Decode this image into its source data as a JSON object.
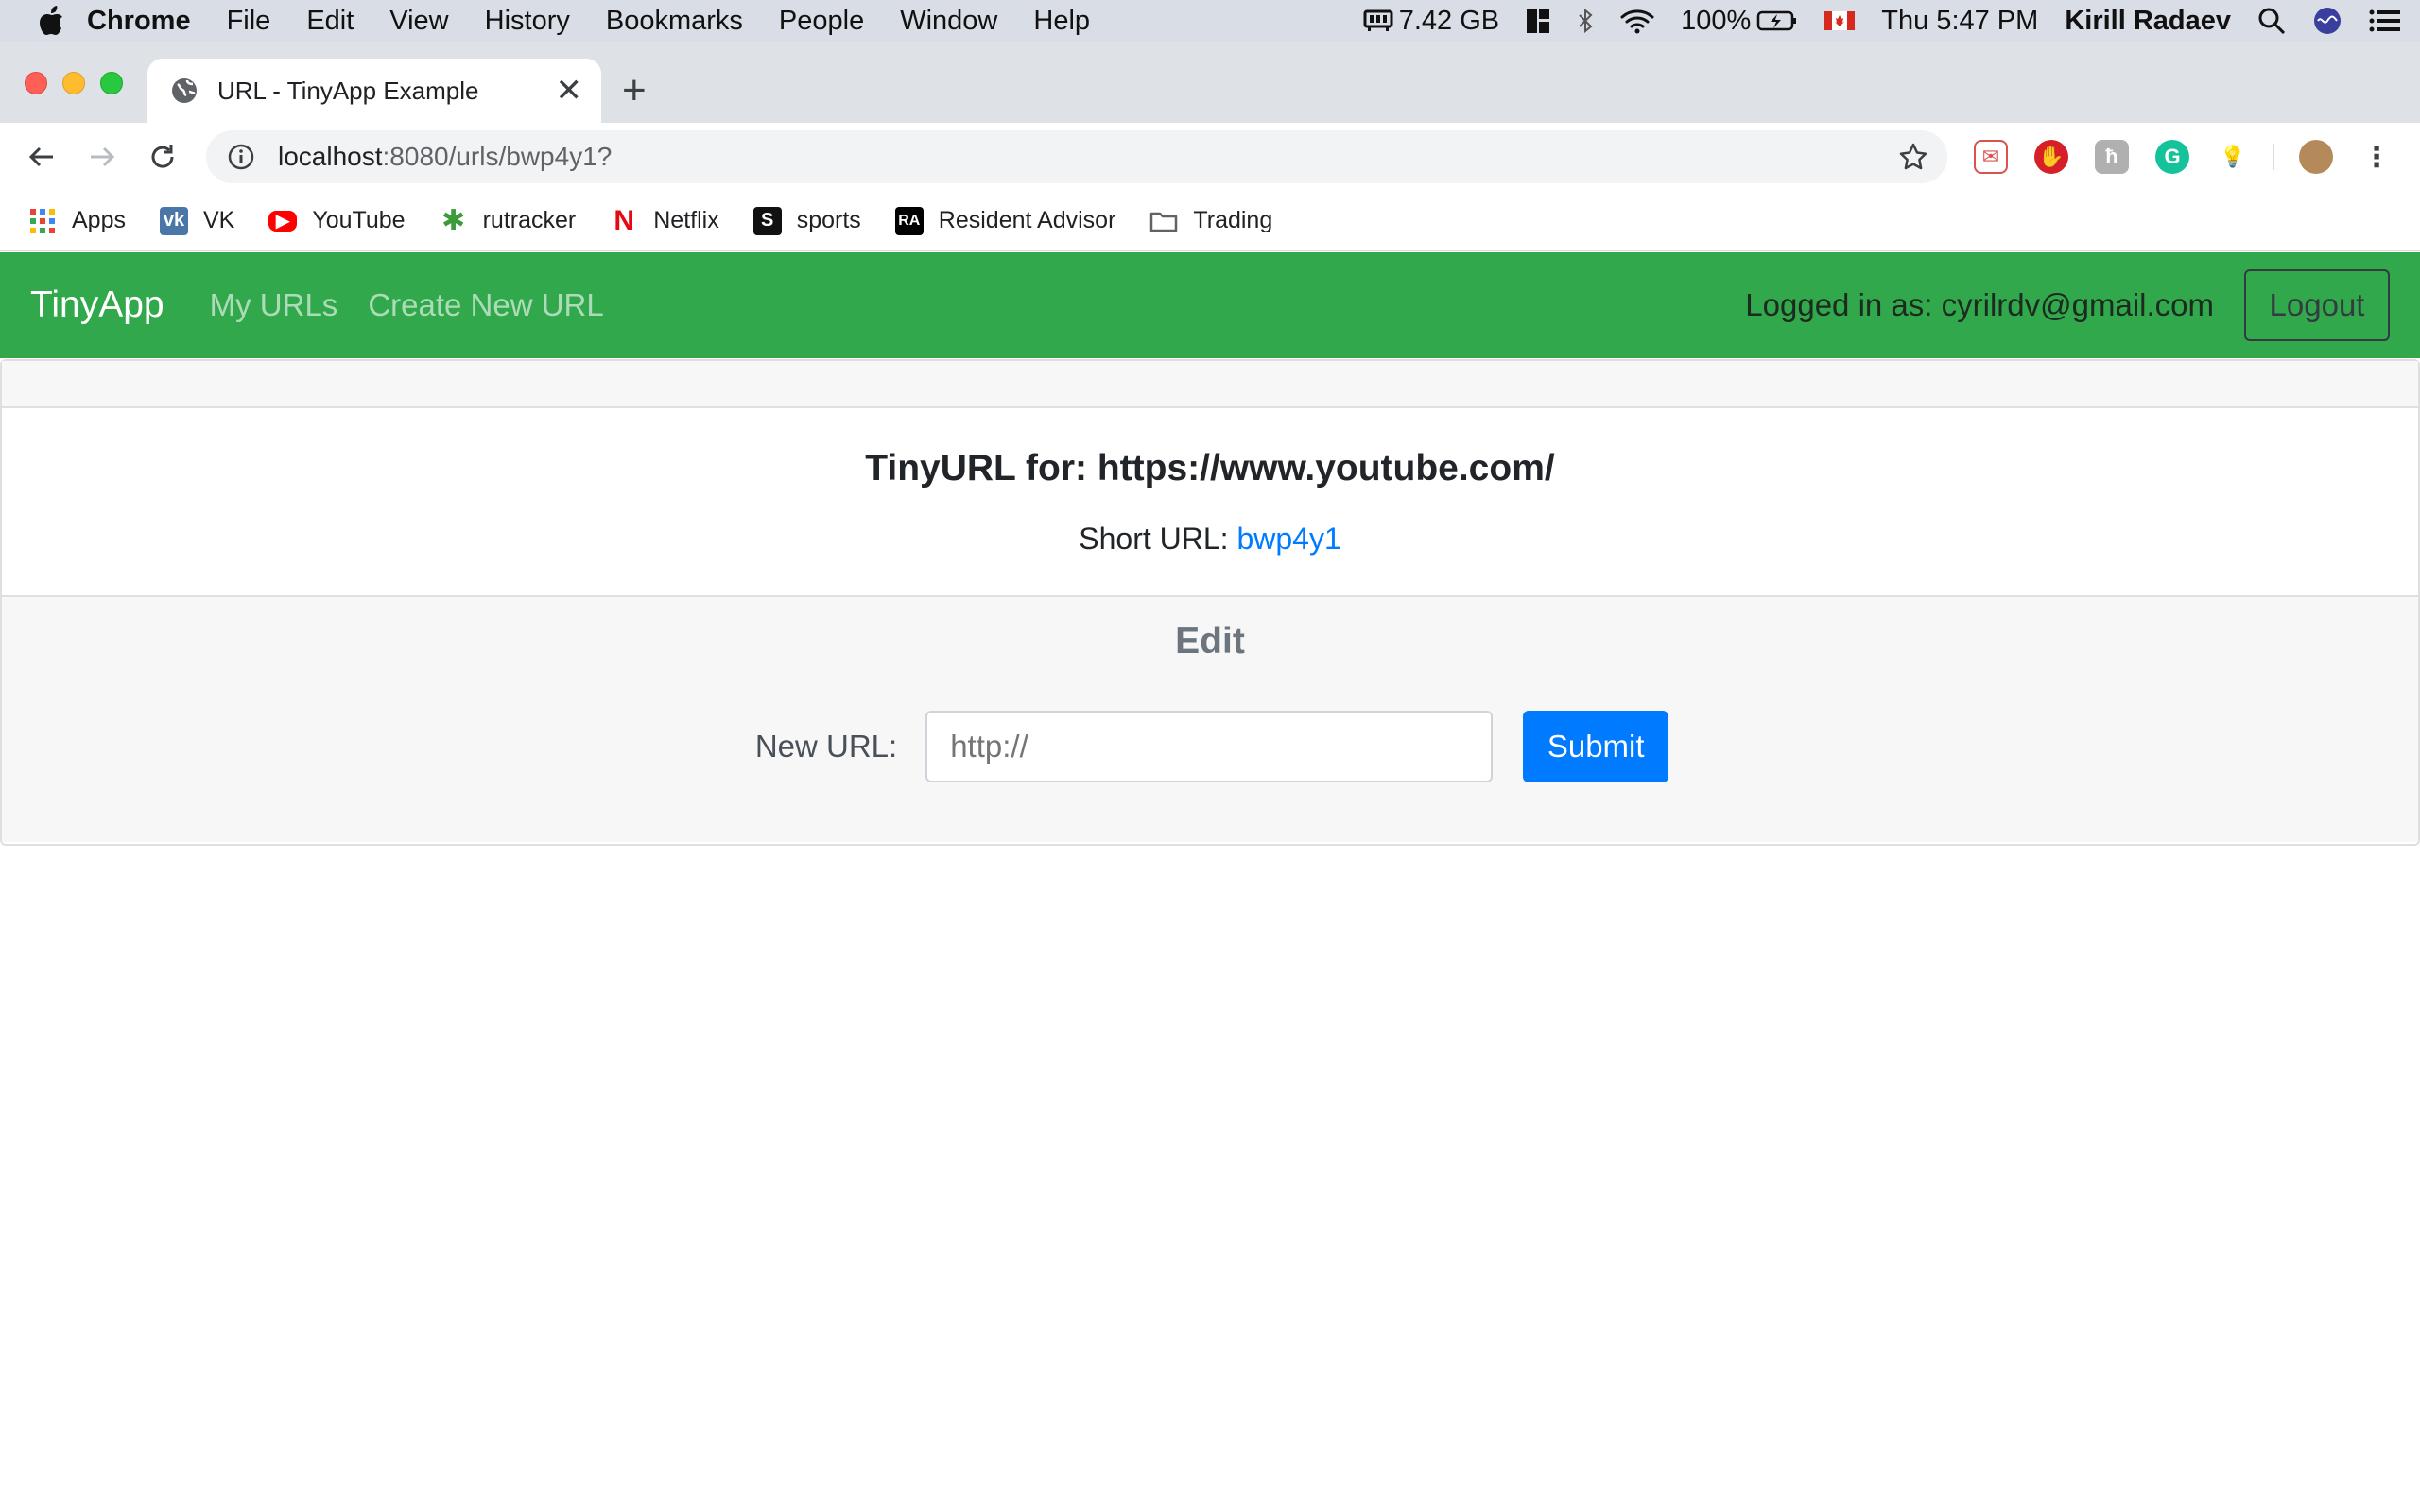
{
  "menubar": {
    "app_name": "Chrome",
    "items": [
      "File",
      "Edit",
      "View",
      "History",
      "Bookmarks",
      "People",
      "Window",
      "Help"
    ],
    "memory": "7.42 GB",
    "battery": "100%",
    "clock": "Thu 5:47 PM",
    "user": "Kirill Radaev"
  },
  "browser": {
    "tab_title": "URL - TinyApp Example",
    "url_host": "localhost",
    "url_path": ":8080/urls/bwp4y1?",
    "bookmarks": [
      {
        "label": "Apps",
        "icon": "apps-grid-icon",
        "color": "#e94235"
      },
      {
        "label": "VK",
        "icon": "vk-icon",
        "color": "#4a76a8"
      },
      {
        "label": "YouTube",
        "icon": "youtube-icon",
        "color": "#ff0000"
      },
      {
        "label": "rutracker",
        "icon": "rutracker-icon",
        "color": "#3b9c3b"
      },
      {
        "label": "Netflix",
        "icon": "netflix-icon",
        "color": "#e50914"
      },
      {
        "label": "sports",
        "icon": "sports-icon",
        "color": "#111111"
      },
      {
        "label": "Resident Advisor",
        "icon": "resident-advisor-icon",
        "color": "#000000"
      },
      {
        "label": "Trading",
        "icon": "folder-icon",
        "color": "#5f6368"
      }
    ]
  },
  "navbar": {
    "brand": "TinyApp",
    "links": [
      "My URLs",
      "Create New URL"
    ],
    "logged_in_text": "Logged in as: cyrilrdv@gmail.com",
    "logout_label": "Logout",
    "color": "#31a84b"
  },
  "card": {
    "title": "TinyURL for: https://www.youtube.com/",
    "short_url_label": "Short URL:",
    "short_url_value": "bwp4y1",
    "edit_heading": "Edit",
    "new_url_label": "New URL:",
    "new_url_placeholder": "http://",
    "submit_label": "Submit",
    "accent": "#007bff"
  }
}
